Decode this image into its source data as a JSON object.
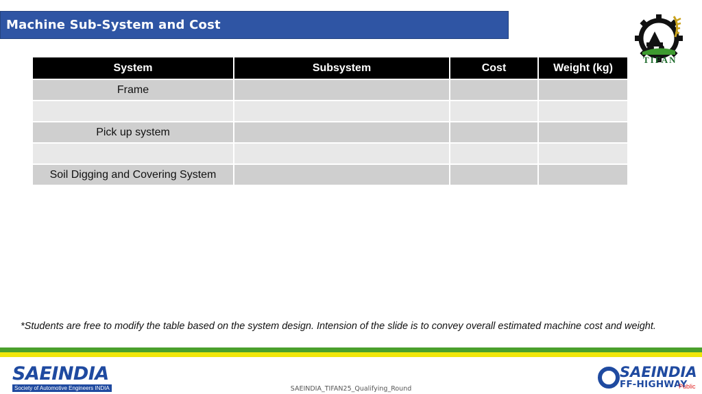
{
  "header": {
    "title": "Machine Sub-System and Cost"
  },
  "logo_tifan": {
    "text": "TIFAN",
    "icon": "tifan-gear-tractor-logo"
  },
  "table": {
    "columns": [
      "System",
      "Subsystem",
      "Cost",
      "Weight (kg)"
    ],
    "rows": [
      {
        "system": "Frame",
        "subsystem": "",
        "cost": "",
        "weight": ""
      },
      {
        "system": "",
        "subsystem": "",
        "cost": "",
        "weight": ""
      },
      {
        "system": "Pick up system",
        "subsystem": "",
        "cost": "",
        "weight": ""
      },
      {
        "system": "",
        "subsystem": "",
        "cost": "",
        "weight": ""
      },
      {
        "system": "Soil Digging and Covering System",
        "subsystem": "",
        "cost": "",
        "weight": ""
      }
    ]
  },
  "note": "*Students are free to modify the table based on the system design. Intension of the slide is to convey overall estimated machine cost and weight.",
  "footer": {
    "left_logo_text": "SAEINDIA",
    "left_logo_sub": "Society of Automotive Engineers INDIA",
    "center_text": "SAEINDIA_TIFAN25_Qualifying_Round",
    "right_logo_word1": "SAEINDIA",
    "right_logo_word2": "FF-HIGHWAY",
    "classification": "Public"
  },
  "colors": {
    "title_bar": "#2f55a4",
    "header_row": "#000000",
    "row_dark": "#cfcfcf",
    "row_light": "#e8e8e8",
    "stripe_green": "#4aa02c",
    "stripe_yellow": "#f0e60a",
    "brand_blue": "#1f4aa0"
  }
}
